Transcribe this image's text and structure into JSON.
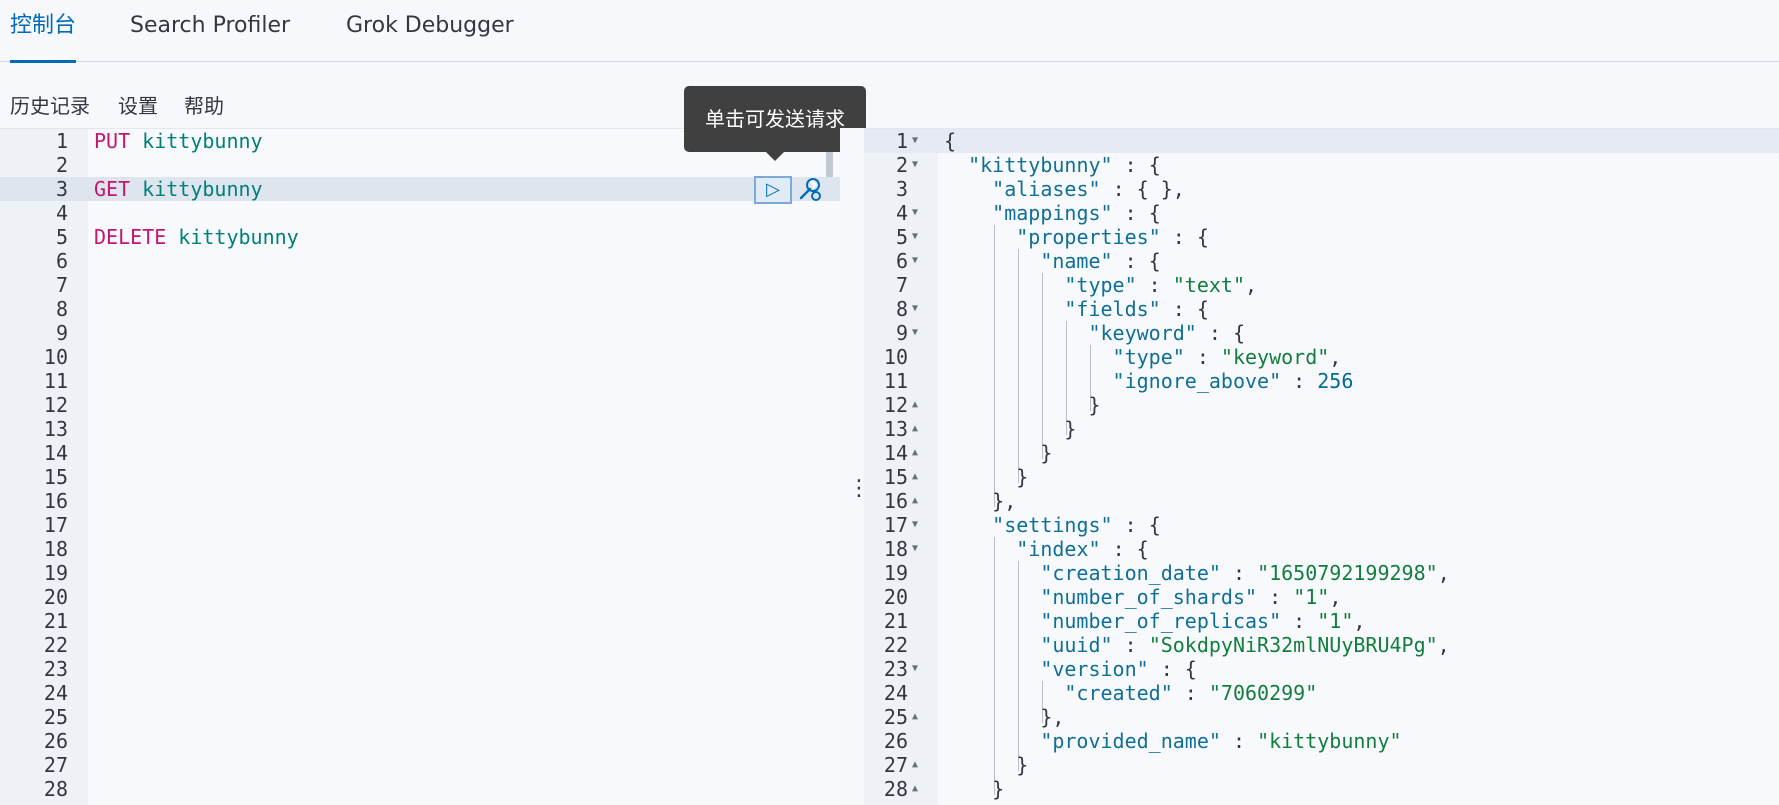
{
  "tabs": [
    {
      "label": "控制台"
    },
    {
      "label": "Search Profiler"
    },
    {
      "label": "Grok Debugger"
    }
  ],
  "toolbar": {
    "history": "历史记录",
    "settings": "设置",
    "help": "帮助"
  },
  "tooltip": "单击可发送请求",
  "request_editor": {
    "line_numbers": [
      "1",
      "2",
      "3",
      "4",
      "5",
      "6",
      "7",
      "8",
      "9",
      "10",
      "11",
      "12",
      "13",
      "14",
      "15",
      "16",
      "17",
      "18",
      "19",
      "20",
      "21",
      "22",
      "23",
      "24",
      "25",
      "26",
      "27",
      "28"
    ],
    "requests": [
      {
        "method": "PUT",
        "path": "kittybunny"
      },
      {
        "method": "GET",
        "path": "kittybunny"
      },
      {
        "method": "DELETE",
        "path": "kittybunny"
      }
    ]
  },
  "response_editor": {
    "line_numbers": [
      "1",
      "2",
      "3",
      "4",
      "5",
      "6",
      "7",
      "8",
      "9",
      "10",
      "11",
      "12",
      "13",
      "14",
      "15",
      "16",
      "17",
      "18",
      "19",
      "20",
      "21",
      "22",
      "23",
      "24",
      "25",
      "26",
      "27",
      "28"
    ],
    "index_name": "kittybunny",
    "mappings": {
      "field_name": "name",
      "field_type": "text",
      "subfield": "keyword",
      "subfield_type": "keyword",
      "ignore_above": "256"
    },
    "settings": {
      "creation_date": "1650792199298",
      "number_of_shards": "1",
      "number_of_replicas": "1",
      "uuid": "SokdpyNiR32mlNUyBRU4Pg",
      "version_created": "7060299",
      "provided_name": "kittybunny"
    }
  },
  "icons": {
    "run": "play-icon",
    "options": "wrench-icon",
    "resize": "vertical-dots-icon",
    "fold": "fold-caret-icon"
  }
}
